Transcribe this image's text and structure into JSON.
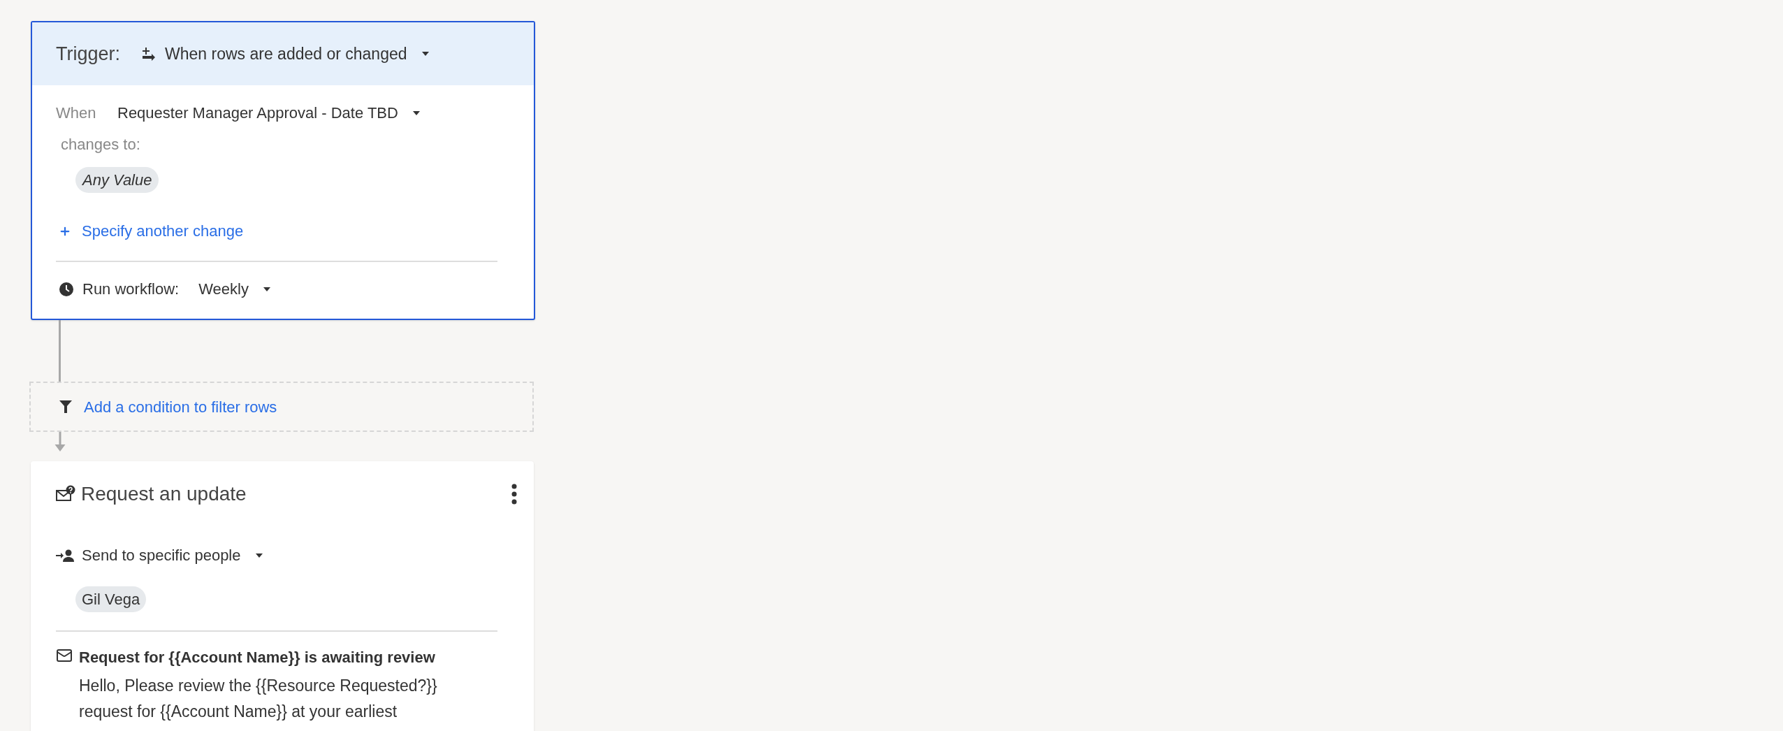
{
  "trigger": {
    "label": "Trigger:",
    "event": "When rows are added or changed",
    "selected": true,
    "when_label": "When",
    "column": "Requester Manager Approval - Date TBD",
    "changes_label": "changes to:",
    "value_chip": "Any Value",
    "add_change_link": "Specify another change",
    "run_label": "Run workflow:",
    "frequency": "Weekly"
  },
  "filter": {
    "link": "Add a condition to filter rows"
  },
  "action": {
    "title": "Request an update",
    "recipients_mode": "Send to specific people",
    "recipients": [
      "Gil Vega"
    ],
    "subject": "Request for {{Account Name}} is awaiting review",
    "message": "Hello, Please review the {{Resource Requested?}}\nrequest for {{Account Name}} at your earliest"
  }
}
